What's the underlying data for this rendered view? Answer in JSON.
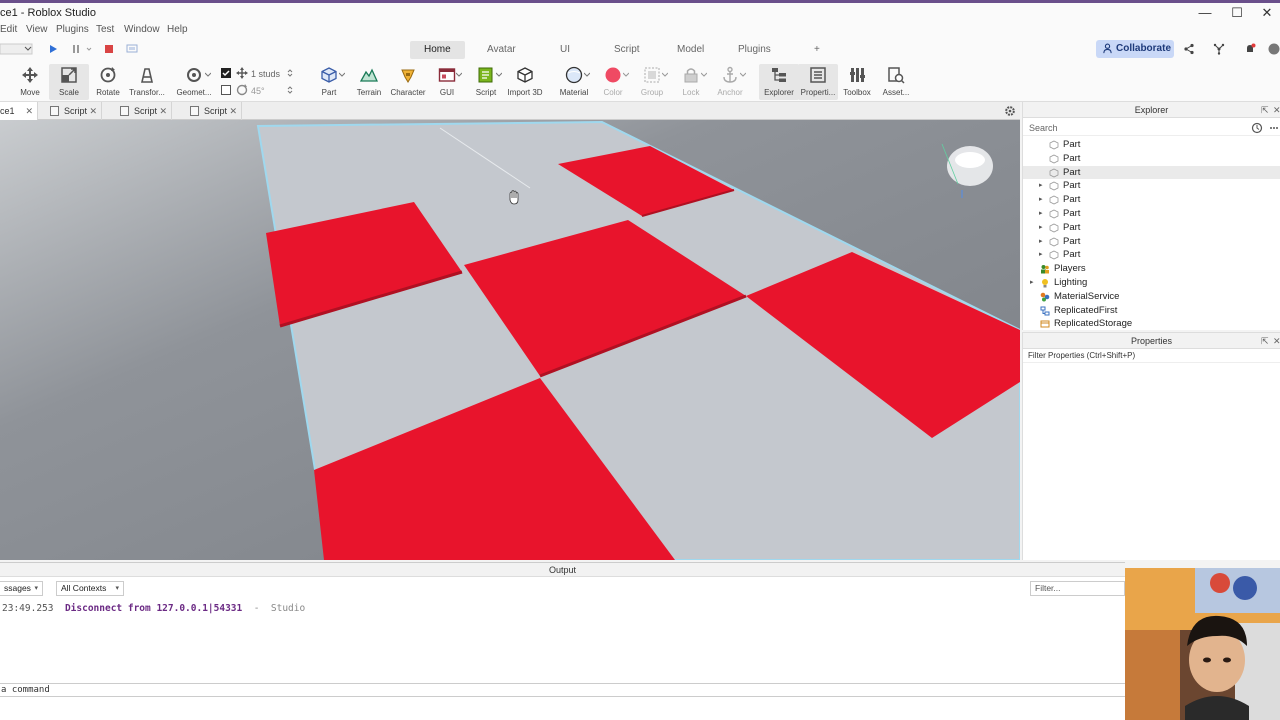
{
  "window": {
    "title": "ce1 - Roblox Studio",
    "minimize": "—",
    "maximize": "☐",
    "close": "✕"
  },
  "menu": [
    "Edit",
    "View",
    "Plugins",
    "Test",
    "Window",
    "Help"
  ],
  "ribbon_tabs": [
    "Home",
    "Avatar",
    "UI",
    "Script",
    "Model",
    "Plugins",
    "+"
  ],
  "active_ribbon_tab": "Home",
  "collaborate_label": "Collaborate",
  "toolbar": {
    "move": "Move",
    "scale": "Scale",
    "rotate": "Rotate",
    "transform": "Transfor...",
    "geometry": "Geomet...",
    "studs": "1 studs",
    "angle": "45°",
    "part": "Part",
    "terrain": "Terrain",
    "character": "Character",
    "gui": "GUI",
    "script": "Script",
    "import3d": "Import 3D",
    "material": "Material",
    "color": "Color",
    "group": "Group",
    "lock": "Lock",
    "anchor": "Anchor",
    "explorer": "Explorer",
    "properties": "Properti...",
    "toolbox": "Toolbox",
    "assets": "Asset..."
  },
  "doc_tabs": {
    "active": "ce1",
    "scripts": [
      "Script",
      "Script",
      "Script"
    ],
    "close": "✕"
  },
  "colors": {
    "red_part": "#e8142c",
    "baseplate": "#c4c8ce",
    "accent": "#c9d8f7",
    "log_message": "#6b2a84"
  },
  "explorer": {
    "title": "Explorer",
    "search_placeholder": "Search",
    "items": [
      {
        "label": "Part",
        "icon": "part-icon"
      },
      {
        "label": "Part",
        "icon": "part-icon"
      },
      {
        "label": "Part",
        "icon": "part-icon"
      },
      {
        "label": "Part",
        "icon": "part-icon"
      },
      {
        "label": "Part",
        "icon": "part-icon"
      },
      {
        "label": "Part",
        "icon": "part-icon"
      },
      {
        "label": "Part",
        "icon": "part-icon"
      },
      {
        "label": "Part",
        "icon": "part-icon"
      },
      {
        "label": "Part",
        "icon": "part-icon"
      },
      {
        "label": "Players",
        "icon": "players-icon"
      },
      {
        "label": "Lighting",
        "icon": "lighting-icon"
      },
      {
        "label": "MaterialService",
        "icon": "material-service-icon"
      },
      {
        "label": "ReplicatedFirst",
        "icon": "replicated-first-icon"
      },
      {
        "label": "ReplicatedStorage",
        "icon": "replicated-storage-icon"
      }
    ]
  },
  "properties": {
    "title": "Properties",
    "filter_placeholder": "Filter Properties (Ctrl+Shift+P)"
  },
  "output": {
    "title": "Output",
    "messages_select": "ssages",
    "contexts_select": "All Contexts",
    "filter_placeholder": "Filter...",
    "log": {
      "time": "23:49.253",
      "message": "Disconnect from 127.0.0.1|54331",
      "separator": "-",
      "source": "Studio"
    },
    "command_placeholder": "a command"
  }
}
